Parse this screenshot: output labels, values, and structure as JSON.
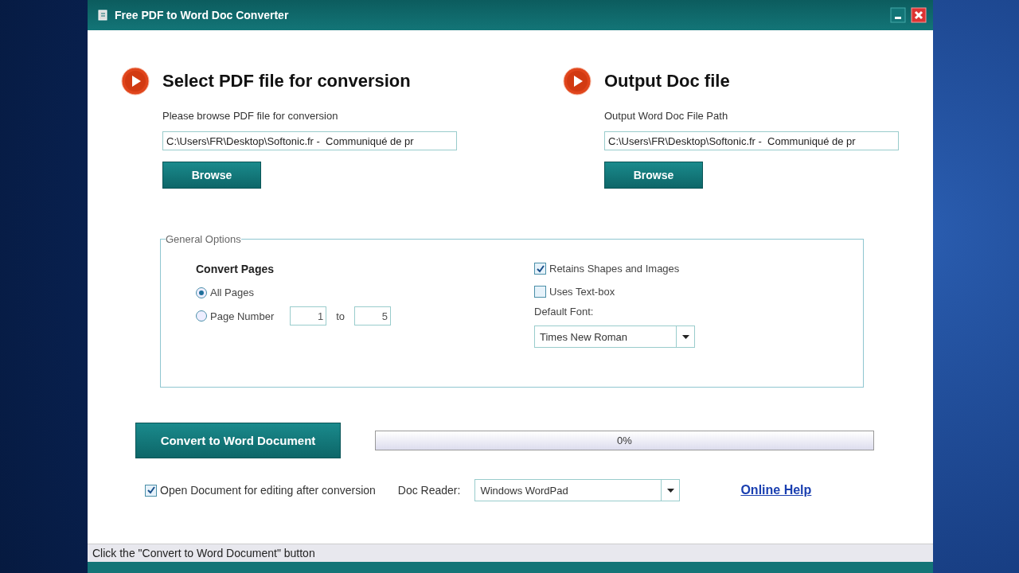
{
  "window": {
    "title": "Free PDF to Word Doc Converter"
  },
  "input_section": {
    "heading": "Select PDF file for conversion",
    "label": "Please browse PDF file for conversion",
    "path": "C:\\Users\\FR\\Desktop\\Softonic.fr -  Communiqué de pr",
    "button": "Browse"
  },
  "output_section": {
    "heading": "Output Doc file",
    "label": "Output Word Doc File Path",
    "path": "C:\\Users\\FR\\Desktop\\Softonic.fr -  Communiqué de pr",
    "button": "Browse"
  },
  "general_options": {
    "title": "General Options",
    "convert_pages_heading": "Convert Pages",
    "page_modes": [
      {
        "label": "All Pages",
        "selected": true
      },
      {
        "label": "Page Number",
        "selected": false
      }
    ],
    "page_from": "1",
    "page_to_label": "to",
    "page_to": "5",
    "checkboxes": [
      {
        "label": "Retains Shapes and Images",
        "checked": true
      },
      {
        "label": "Uses Text-box",
        "checked": false
      }
    ],
    "default_font_label": "Default Font:",
    "default_font": "Times New Roman"
  },
  "convert_button": "Convert to Word Document",
  "progress": {
    "level": 0,
    "reading": "0%"
  },
  "open_after": {
    "label": "Open Document for editing after conversion",
    "checked": true
  },
  "doc_reader": {
    "label": "Doc Reader:",
    "value": "Windows WordPad"
  },
  "help_link": "Online Help",
  "status_bar": "Click the \"Convert to Word Document\" button"
}
